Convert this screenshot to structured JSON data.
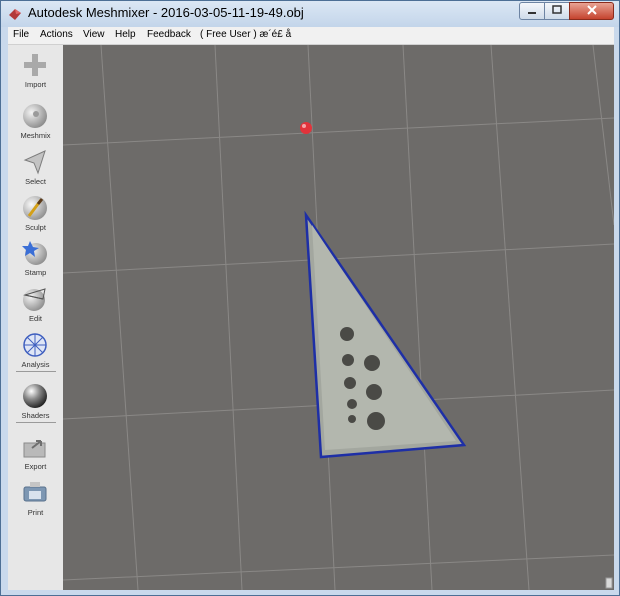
{
  "window": {
    "title": "Autodesk Meshmixer - 2016-03-05-11-19-49.obj",
    "icons": {
      "app": "meshmixer-logo-icon",
      "minimize": "minimize-icon",
      "maximize": "maximize-icon",
      "close": "close-icon"
    }
  },
  "menu": {
    "file": "File",
    "actions": "Actions",
    "view": "View",
    "help": "Help",
    "feedback": "Feedback",
    "user": "( Free User ) æ´é£ å"
  },
  "tools": {
    "import": "Import",
    "meshmix": "Meshmix",
    "select": "Select",
    "sculpt": "Sculpt",
    "stamp": "Stamp",
    "edit": "Edit",
    "analysis": "Analysis",
    "shaders": "Shaders",
    "export": "Export",
    "print": "Print"
  },
  "colors": {
    "viewport_bg": "#6d6b69",
    "grid_line": "#8a8886",
    "model_outline": "#1e2fa6",
    "model_fill": "#a3a79f",
    "pivot": "#e2333b",
    "close_button": "#c5432e"
  }
}
